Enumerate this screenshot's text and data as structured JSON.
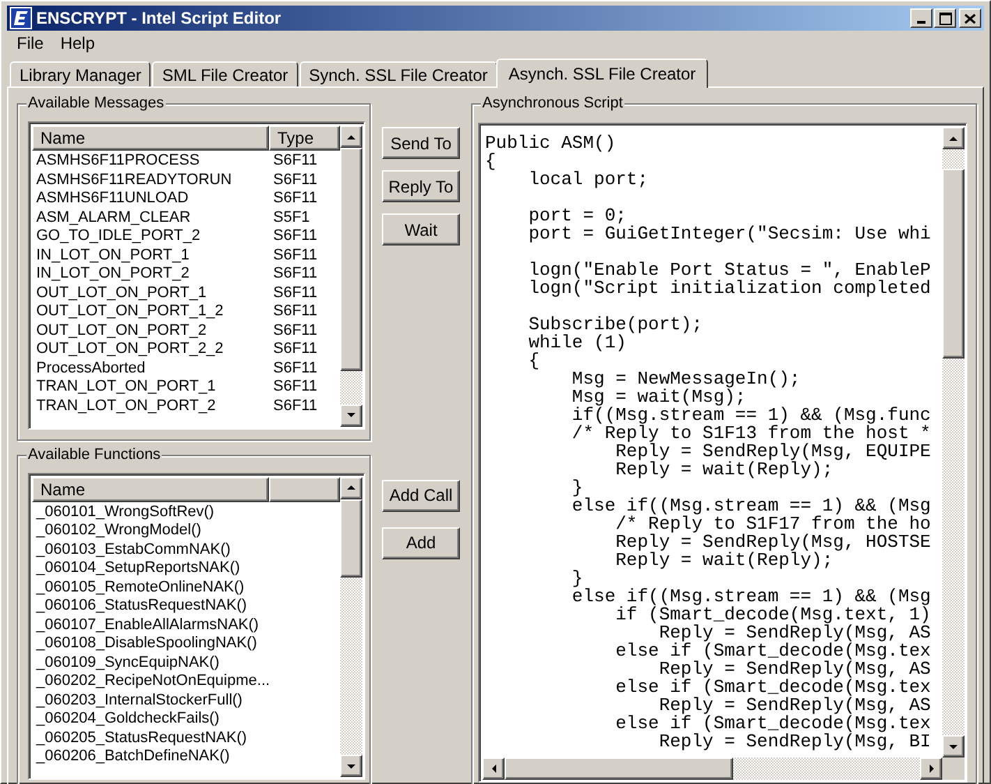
{
  "window": {
    "title": "ENSCRYPT - Intel Script Editor"
  },
  "menu": [
    {
      "label": "File"
    },
    {
      "label": "Help"
    }
  ],
  "tabs": [
    {
      "label": "Library Manager",
      "selected": false
    },
    {
      "label": "SML File Creator",
      "selected": false
    },
    {
      "label": "Synch. SSL File Creator",
      "selected": false
    },
    {
      "label": "Asynch. SSL File Creator",
      "selected": true
    }
  ],
  "messages": {
    "title": "Available Messages",
    "columns": [
      "Name",
      "Type"
    ],
    "rows": [
      {
        "name": "ASMHS6F11PROCESS",
        "type": "S6F11"
      },
      {
        "name": "ASMHS6F11READYTORUN",
        "type": "S6F11"
      },
      {
        "name": "ASMHS6F11UNLOAD",
        "type": "S6F11"
      },
      {
        "name": "ASM_ALARM_CLEAR",
        "type": "S5F1"
      },
      {
        "name": "GO_TO_IDLE_PORT_2",
        "type": "S6F11"
      },
      {
        "name": "IN_LOT_ON_PORT_1",
        "type": "S6F11"
      },
      {
        "name": "IN_LOT_ON_PORT_2",
        "type": "S6F11"
      },
      {
        "name": "OUT_LOT_ON_PORT_1",
        "type": "S6F11"
      },
      {
        "name": "OUT_LOT_ON_PORT_1_2",
        "type": "S6F11"
      },
      {
        "name": "OUT_LOT_ON_PORT_2",
        "type": "S6F11"
      },
      {
        "name": "OUT_LOT_ON_PORT_2_2",
        "type": "S6F11"
      },
      {
        "name": "ProcessAborted",
        "type": "S6F11"
      },
      {
        "name": "TRAN_LOT_ON_PORT_1",
        "type": "S6F11"
      },
      {
        "name": "TRAN_LOT_ON_PORT_2",
        "type": "S6F11"
      }
    ]
  },
  "message_buttons": [
    "Send To",
    "Reply To",
    "Wait"
  ],
  "functions": {
    "title": "Available Functions",
    "columns": [
      "Name"
    ],
    "rows": [
      "_060101_WrongSoftRev()",
      "_060102_WrongModel()",
      "_060103_EstabCommNAK()",
      "_060104_SetupReportsNAK()",
      "_060105_RemoteOnlineNAK()",
      "_060106_StatusRequestNAK()",
      "_060107_EnableAllAlarmsNAK()",
      "_060108_DisableSpoolingNAK()",
      "_060109_SyncEquipNAK()",
      "_060202_RecipeNotOnEquipme...",
      "_060203_InternalStockerFull()",
      "_060204_GoldcheckFails()",
      "_060205_StatusRequestNAK()",
      "_060206_BatchDefineNAK()"
    ]
  },
  "function_buttons": [
    "Add Call",
    "Add"
  ],
  "script": {
    "title": "Asynchronous Script",
    "code": "Public ASM()\n{\n    local port;\n\n    port = 0;\n    port = GuiGetInteger(\"Secsim: Use whi\n\n    logn(\"Enable Port Status = \", EnableP\n    logn(\"Script initialization completed\n\n    Subscribe(port);\n    while (1)\n    {\n        Msg = NewMessageIn();\n        Msg = wait(Msg);\n        if((Msg.stream == 1) && (Msg.func\n        /* Reply to S1F13 from the host *\n            Reply = SendReply(Msg, EQUIPE\n            Reply = wait(Reply);\n        }\n        else if((Msg.stream == 1) && (Msg\n            /* Reply to S1F17 from the ho\n            Reply = SendReply(Msg, HOSTSE\n            Reply = wait(Reply);\n        }\n        else if((Msg.stream == 1) && (Msg\n            if (Smart_decode(Msg.text, 1)\n                Reply = SendReply(Msg, AS\n            else if (Smart_decode(Msg.tex\n                Reply = SendReply(Msg, AS\n            else if (Smart_decode(Msg.tex\n                Reply = SendReply(Msg, AS\n            else if (Smart_decode(Msg.tex\n                Reply = SendReply(Msg, BI"
  }
}
